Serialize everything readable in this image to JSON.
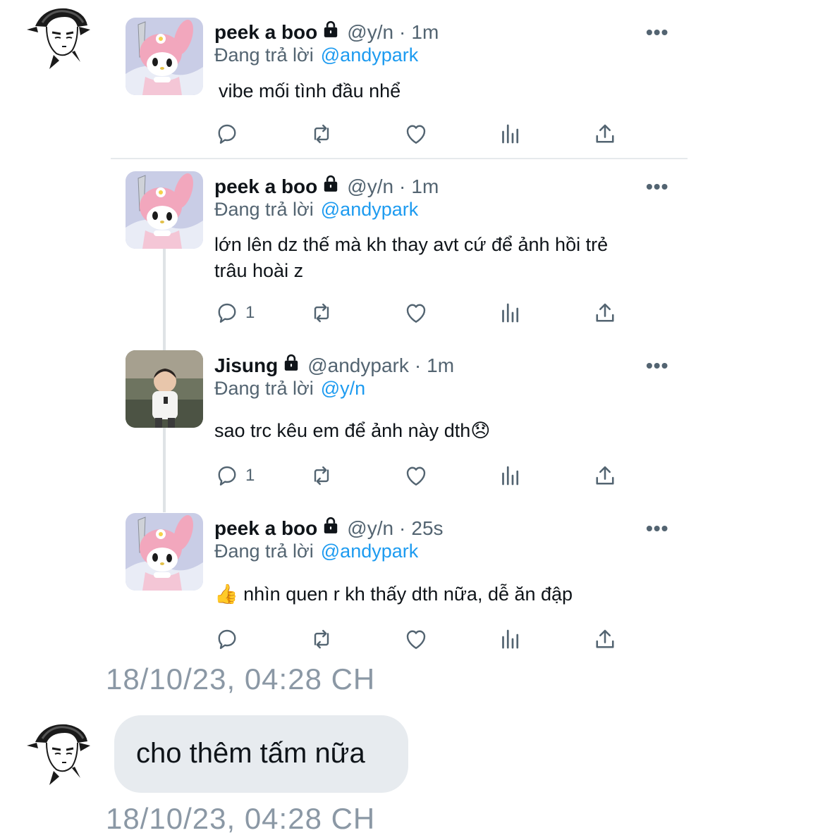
{
  "tweets": [
    {
      "name": "peek a boo",
      "handle": "@y/n",
      "time": "1m",
      "replying_prefix": "Đang trả lời",
      "replying_to": "@andypark",
      "text": "vibe mối tình đầu nhể",
      "reply_count": ""
    },
    {
      "name": "peek a boo",
      "handle": "@y/n",
      "time": "1m",
      "replying_prefix": "Đang trả lời",
      "replying_to": "@andypark",
      "text_line1": "lớn lên dz thế mà kh thay avt cứ để ảnh hồi trẻ",
      "text_line2": "trâu hoài z",
      "reply_count": "1"
    },
    {
      "name": "Jisung",
      "handle": "@andypark",
      "time": "1m",
      "replying_prefix": "Đang trả lời",
      "replying_to": "@y/n",
      "text": "sao trc kêu em để ảnh này dth",
      "emoji": "😞",
      "reply_count": "1"
    },
    {
      "name": "peek a boo",
      "handle": "@y/n",
      "time": "25s",
      "replying_prefix": "Đang trả lời",
      "replying_to": "@andypark",
      "emoji": "👍",
      "text": "nhìn quen r kh thấy dth nữa, dễ ăn đập",
      "reply_count": ""
    }
  ],
  "more_glyph": "•••",
  "dot_sep": "·",
  "message_timestamp_1": "18/10/23, 04:28 CH",
  "message_text": "cho thêm tấm nữa",
  "message_timestamp_2": "18/10/23, 04:28 CH",
  "icons": [
    "reply-icon",
    "retweet-icon",
    "like-icon",
    "views-icon",
    "share-icon",
    "lock-icon"
  ],
  "colors": {
    "link": "#1d9bf0",
    "muted": "#536471",
    "bubble": "#e7ebef",
    "timestamp": "#8b98a5"
  }
}
